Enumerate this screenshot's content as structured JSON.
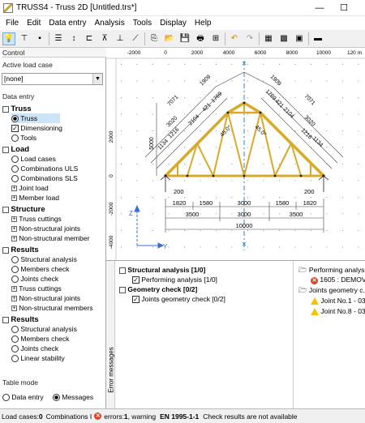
{
  "window": {
    "title": "TRUSS4 - Truss 2D [Untitled.trs*]",
    "minimize": "—",
    "maximize": "☐"
  },
  "menu": [
    "File",
    "Edit",
    "Data entry",
    "Analysis",
    "Tools",
    "Display",
    "Help"
  ],
  "control": {
    "header": "Control",
    "active_load_case_label": "Active load case",
    "active_load_case_value": "[none]",
    "data_entry_label": "Data entry",
    "sections": {
      "truss": "Truss",
      "load": "Load",
      "structure": "Structure",
      "results1": "Results",
      "results2": "Results"
    },
    "truss_items": [
      "Truss",
      "Dimensioning",
      "Tools"
    ],
    "load_items": [
      "Load cases",
      "Combinations ULS",
      "Combinations SLS",
      "Joint load",
      "Member load"
    ],
    "structure_items": [
      "Truss cuttings",
      "Non-structural joints",
      "Non-structural member"
    ],
    "results1_items": [
      "Structural analysis",
      "Members check",
      "Joints check",
      "Truss cuttings",
      "Non-structural joints",
      "Non-structural members"
    ],
    "results2_items": [
      "Structural analysis",
      "Members check",
      "Joints check",
      "Linear stability"
    ],
    "table_mode_label": "Table mode",
    "table_mode_data_entry": "Data entry",
    "table_mode_messages": "Messages"
  },
  "ruler": {
    "top_ticks": [
      "-2000",
      "0",
      "2000",
      "4000",
      "6000",
      "8000",
      "10000",
      "120 m"
    ],
    "left_ticks": [
      "2000",
      "0",
      "-2000",
      "-4000"
    ]
  },
  "drawing": {
    "dims_top_left": [
      "7071",
      "1909",
      "3020",
      "2104",
      "421",
      "1769",
      "1134",
      "1216"
    ],
    "dims_top_right": [
      "1909",
      "7071",
      "1769",
      "421",
      "2104",
      "3020",
      "1216",
      "1134"
    ],
    "height_label": "5000",
    "angle_left": "45.0°",
    "angle_right": "45.0°",
    "support_left": "200",
    "support_right": "200",
    "row1": [
      "1820",
      "1580",
      "3000",
      "1580",
      "1820"
    ],
    "row2": [
      "3500",
      "3000",
      "3500"
    ],
    "total": "10000",
    "axis_z": "Z",
    "axis_y": "Y"
  },
  "messages": {
    "side_label": "Error messages",
    "structural": "Structural analysis [1/0]",
    "structural_item": "Performing analysis [1/0]",
    "geometry": "Geometry check [0/2]",
    "geometry_item": "Joints geometry check [0/2]",
    "right_header1": "Performing analysis",
    "right_err": "1605 : DEMOV...",
    "right_header2": "Joints geometry c...",
    "right_w1": "Joint No.1 - 03...",
    "right_w2": "Joint No.8 - 03..."
  },
  "status": {
    "load_cases": "Load cases: ",
    "load_cases_val": "0",
    "combinations": "Combinations I",
    "errors": "errors: ",
    "errors_val": "1",
    "warning": ", warning",
    "standard": "EN 1995-1-1",
    "check": "Check results are not available"
  },
  "colors": {
    "member": "#d8a92a",
    "dim": "#444444",
    "axis_blue": "#3a6fd8",
    "sym_blue": "#2f86c6"
  }
}
